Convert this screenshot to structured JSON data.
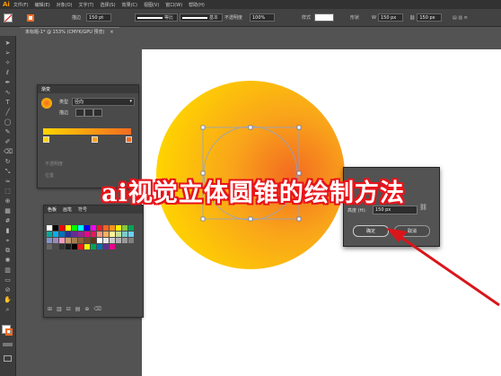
{
  "app": {
    "logo": "Ai"
  },
  "menu": [
    "文件(F)",
    "编辑(E)",
    "对象(O)",
    "文字(T)",
    "选择(S)",
    "效果(C)",
    "视图(V)",
    "窗口(W)",
    "帮助(H)"
  ],
  "control_bar": {
    "stroke_label": "描边",
    "stroke_value": "150 pt",
    "profile_label": "等比",
    "brush_label": "基本",
    "opacity_label": "不透明度",
    "opacity_value": "100%",
    "style_label": "样式",
    "shape_label": "形状",
    "w_value": "150 px",
    "h_value": "150 px"
  },
  "document_tab": {
    "title": "未标题-1* @ 153% (CMYK/GPU 预览)"
  },
  "gradient_panel": {
    "title": "渐变",
    "type_label": "类型",
    "type_value": "径向",
    "stroke_label": "描边",
    "opacity_label": "不透明度",
    "location_label": "位置",
    "colors": {
      "start": "#ffd400",
      "end": "#f36b21"
    }
  },
  "swatches_panel": {
    "tabs": [
      "色板",
      "画笔",
      "符号"
    ],
    "colors": [
      "#ffffff",
      "#000000",
      "#ff0000",
      "#ffff00",
      "#00ff00",
      "#00ffff",
      "#0000ff",
      "#ff00ff",
      "#ed1c24",
      "#f26522",
      "#f7941d",
      "#fff200",
      "#8dc63f",
      "#00a651",
      "#00a99d",
      "#00aeef",
      "#0072bc",
      "#2e3192",
      "#662d91",
      "#92278f",
      "#ec008c",
      "#ed145b",
      "#f69679",
      "#fbaf5d",
      "#fff799",
      "#c4df9b",
      "#7accc8",
      "#6dcff6",
      "#8393ca",
      "#a186be",
      "#f49ac1",
      "#c69c6d",
      "#a67c52",
      "#8c6239",
      "#754c24",
      "#603913",
      "#ffffff",
      "#e6e6e6",
      "#cccccc",
      "#b3b3b3",
      "#999999",
      "#808080",
      "#666666",
      "#4d4d4d",
      "#333333",
      "#1a1a1a",
      "#000000",
      "#ed1c24",
      "#fff200",
      "#00a651",
      "#0072bc",
      "#662d91",
      "#ec008c"
    ]
  },
  "dialog": {
    "height_label": "高度 (H):",
    "height_value": "150 px",
    "ok_label": "确定",
    "cancel_label": "取消"
  },
  "artwork": {
    "gradient_colors": [
      "#ffd400",
      "#f9a51a",
      "#f36b21"
    ]
  },
  "caption": "ai视觉立体圆锥的绘制方法"
}
